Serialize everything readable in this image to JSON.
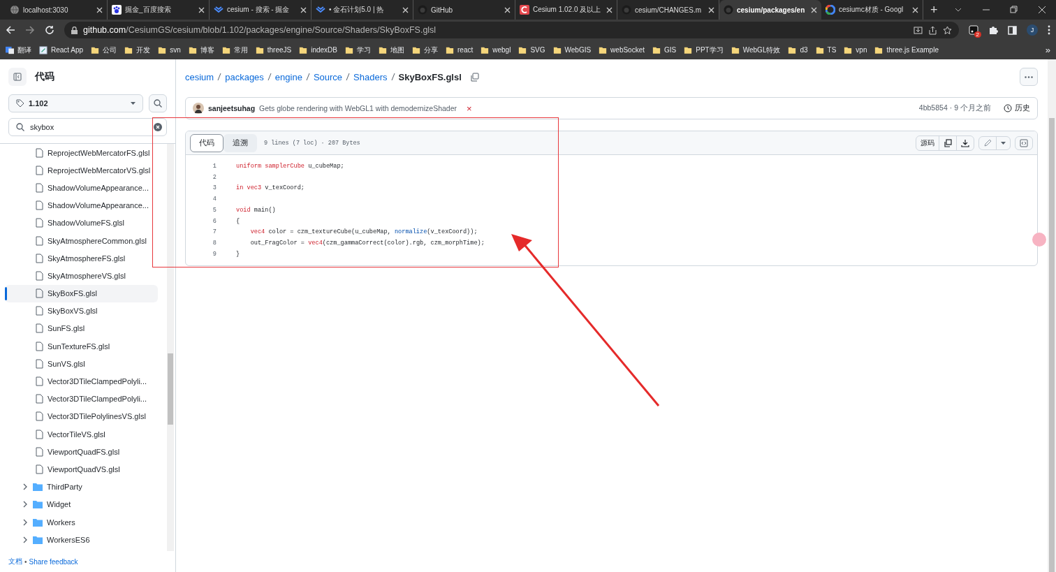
{
  "browser": {
    "tabs": [
      {
        "title": "localhost:3030",
        "kind": "globe",
        "selected": false
      },
      {
        "title": "掘金_百度搜索",
        "kind": "paw",
        "selected": false
      },
      {
        "title": "cesium - 搜索 - 掘金",
        "kind": "chevron",
        "selected": false
      },
      {
        "title": "• 金石计划5.0 | 热",
        "kind": "chevron",
        "selected": false
      },
      {
        "title": "GitHub",
        "kind": "octocat",
        "selected": false
      },
      {
        "title": "Cesium 1.02.0 及以上",
        "kind": "redsquare",
        "selected": false
      },
      {
        "title": "cesium/CHANGES.m",
        "kind": "octocat",
        "selected": false
      },
      {
        "title": "cesium/packages/en",
        "kind": "octocat",
        "selected": true
      },
      {
        "title": "cesiumc材质 - Googl",
        "kind": "google",
        "selected": false
      }
    ],
    "new_tab": "+",
    "address": {
      "host": "github.com",
      "path": "/CesiumGS/cesium/blob/1.102/packages/engine/Source/Shaders/SkyBoxFS.glsl"
    },
    "extension_badge": "2",
    "profile": "J",
    "bookmarks": [
      {
        "label": "翻译",
        "kind": "translate"
      },
      {
        "label": "React App",
        "kind": "app"
      },
      {
        "label": "公司",
        "kind": "folder"
      },
      {
        "label": "开发",
        "kind": "folder"
      },
      {
        "label": "svn",
        "kind": "folder"
      },
      {
        "label": "博客",
        "kind": "folder"
      },
      {
        "label": "常用",
        "kind": "folder"
      },
      {
        "label": "threeJS",
        "kind": "folder"
      },
      {
        "label": "indexDB",
        "kind": "folder"
      },
      {
        "label": "学习",
        "kind": "folder"
      },
      {
        "label": "地图",
        "kind": "folder"
      },
      {
        "label": "分享",
        "kind": "folder"
      },
      {
        "label": "react",
        "kind": "folder"
      },
      {
        "label": "webgl",
        "kind": "folder"
      },
      {
        "label": "SVG",
        "kind": "folder"
      },
      {
        "label": "WebGIS",
        "kind": "folder"
      },
      {
        "label": "webSocket",
        "kind": "folder"
      },
      {
        "label": "GIS",
        "kind": "folder"
      },
      {
        "label": "PPT学习",
        "kind": "folder"
      },
      {
        "label": "WebGL特效",
        "kind": "folder"
      },
      {
        "label": "d3",
        "kind": "folder"
      },
      {
        "label": "TS",
        "kind": "folder"
      },
      {
        "label": "vpn",
        "kind": "folder"
      },
      {
        "label": "three.js Example",
        "kind": "folder"
      }
    ],
    "bookmarks_overflow": "»"
  },
  "sidebar": {
    "title": "代码",
    "branch": "1.102",
    "filter": {
      "value": "skybox"
    },
    "tree": [
      {
        "children": [
          {
            "kind": "file",
            "label": "ReprojectWebMercatorFS.glsl",
            "selected": false
          },
          {
            "kind": "file",
            "label": "ReprojectWebMercatorVS.glsl",
            "selected": false
          },
          {
            "kind": "file",
            "label": "ShadowVolumeAppearance...",
            "selected": false
          },
          {
            "kind": "file",
            "label": "ShadowVolumeAppearance...",
            "selected": false
          },
          {
            "kind": "file",
            "label": "ShadowVolumeFS.glsl",
            "selected": false
          },
          {
            "kind": "file",
            "label": "SkyAtmosphereCommon.glsl",
            "selected": false
          },
          {
            "kind": "file",
            "label": "SkyAtmosphereFS.glsl",
            "selected": false
          },
          {
            "kind": "file",
            "label": "SkyAtmosphereVS.glsl",
            "selected": false
          },
          {
            "kind": "file",
            "label": "SkyBoxFS.glsl",
            "selected": true
          },
          {
            "kind": "file",
            "label": "SkyBoxVS.glsl",
            "selected": false
          },
          {
            "kind": "file",
            "label": "SunFS.glsl",
            "selected": false
          },
          {
            "kind": "file",
            "label": "SunTextureFS.glsl",
            "selected": false
          },
          {
            "kind": "file",
            "label": "SunVS.glsl",
            "selected": false
          },
          {
            "kind": "file",
            "label": "Vector3DTileClampedPolyli...",
            "selected": false
          },
          {
            "kind": "file",
            "label": "Vector3DTileClampedPolyli...",
            "selected": false
          },
          {
            "kind": "file",
            "label": "Vector3DTilePolylinesVS.glsl",
            "selected": false
          },
          {
            "kind": "file",
            "label": "VectorTileVS.glsl",
            "selected": false
          },
          {
            "kind": "file",
            "label": "ViewportQuadFS.glsl",
            "selected": false
          },
          {
            "kind": "file",
            "label": "ViewportQuadVS.glsl",
            "selected": false
          }
        ]
      },
      {
        "kind": "folder",
        "label": "ThirdParty",
        "expanded": false
      },
      {
        "kind": "folder",
        "label": "Widget",
        "expanded": false
      },
      {
        "kind": "folder",
        "label": "Workers",
        "expanded": false
      },
      {
        "kind": "folder",
        "label": "WorkersES6",
        "expanded": false
      }
    ],
    "footer": {
      "docs": "文档",
      "separator": "•",
      "feedback": "Share feedback"
    }
  },
  "main": {
    "breadcrumb": [
      "cesium",
      "packages",
      "engine",
      "Source",
      "Shaders"
    ],
    "file_name": "SkyBoxFS.glsl",
    "commit": {
      "author": "sanjeetsuhag",
      "message": "Gets globe rendering with WebGL1 with demodernizeShader",
      "status": "×",
      "sha": "4bb5854",
      "separator": "·",
      "time": "9 个月之前",
      "history": "历史"
    },
    "view_tabs": [
      {
        "label": "代码",
        "selected": true
      },
      {
        "label": "追溯",
        "selected": false
      }
    ],
    "stats": "9 lines (7 loc) · 207 Bytes",
    "raw": "源码",
    "code": [
      {
        "number": "1",
        "tokens": [
          {
            "kind": "keyword",
            "text": "uniform samplerCube"
          },
          {
            "kind": "plain",
            "text": " u_cubeMap;"
          }
        ]
      },
      {
        "number": "2"
      },
      {
        "number": "3",
        "tokens": [
          {
            "kind": "keyword",
            "text": "in vec3"
          },
          {
            "kind": "plain",
            "text": " v_texCoord;"
          }
        ]
      },
      {
        "number": "4"
      },
      {
        "number": "5",
        "tokens": [
          {
            "kind": "keyword",
            "text": "void"
          },
          {
            "kind": "plain",
            "text": " main()"
          }
        ]
      },
      {
        "number": "6",
        "tokens": [
          {
            "kind": "plain",
            "text": "{"
          }
        ]
      },
      {
        "number": "7",
        "tokens": [
          {
            "kind": "keyword",
            "text": "    vec4"
          },
          {
            "kind": "plain",
            "text": " color = czm_textureCube(u_cubeMap, "
          },
          {
            "kind": "function",
            "text": "normalize"
          },
          {
            "kind": "plain",
            "text": "(v_texCoord));"
          }
        ]
      },
      {
        "number": "8",
        "tokens": [
          {
            "kind": "plain",
            "text": "    out_FragColor = "
          },
          {
            "kind": "keyword",
            "text": "vec4"
          },
          {
            "kind": "plain",
            "text": "(czm_gammaCorrect(color).rgb, czm_morphTime);"
          }
        ]
      },
      {
        "number": "9",
        "tokens": [
          {
            "kind": "plain",
            "text": "}"
          }
        ]
      }
    ]
  }
}
